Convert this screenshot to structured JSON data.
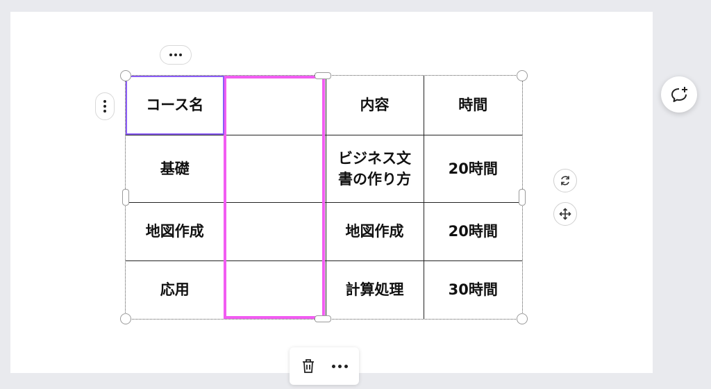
{
  "table": {
    "rows": [
      [
        "コース名",
        "",
        "内容",
        "時間"
      ],
      [
        "基礎",
        "",
        "ビジネス文書の作り方",
        "20時間"
      ],
      [
        "地図作成",
        "",
        "地図作成",
        "20時間"
      ],
      [
        "応用",
        "",
        "計算処理",
        "30時間"
      ]
    ]
  },
  "icons": {
    "more": "more-horizontal-icon",
    "row_more": "more-vertical-icon",
    "rotate": "rotate-icon",
    "move": "move-icon",
    "comment": "add-comment-icon",
    "delete": "trash-icon"
  },
  "colors": {
    "column_highlight": "#f25cf2",
    "cell_selection": "#8b5cf6",
    "canvas": "#ffffff",
    "background": "#e9eaee"
  }
}
